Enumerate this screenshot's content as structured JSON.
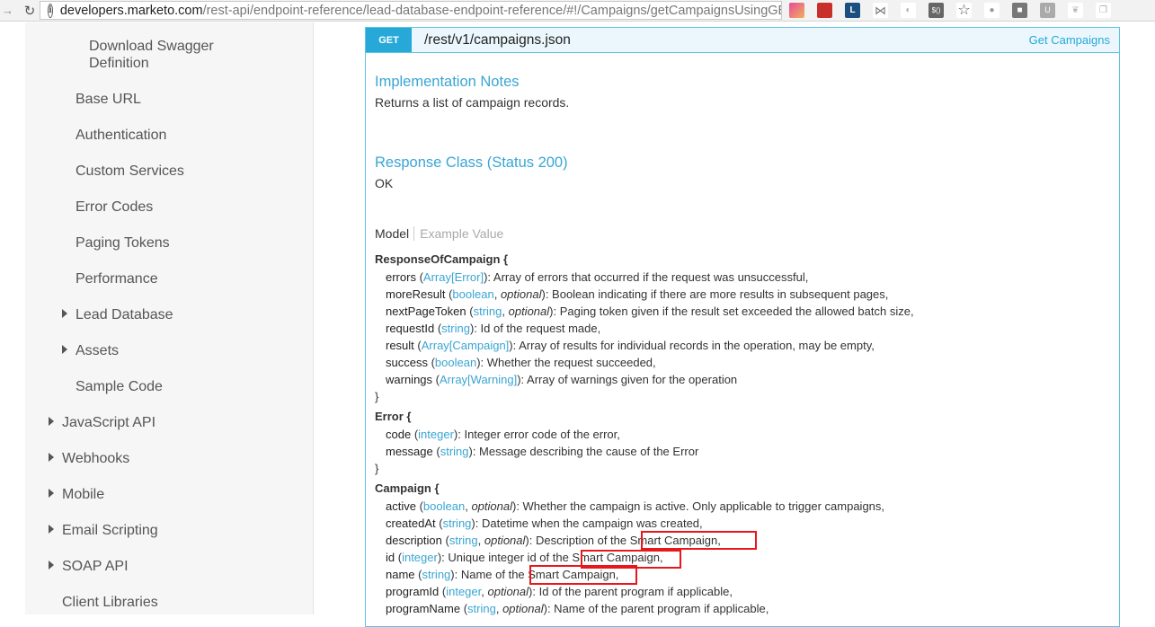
{
  "browser": {
    "url_host": "developers.marketo.com",
    "url_path": "/rest-api/endpoint-reference/lead-database-endpoint-reference/#!/Campaigns/getCampaignsUsingGE"
  },
  "sidebar": {
    "items": [
      {
        "label": "Download Swagger",
        "label2": "Definition"
      },
      {
        "label": "Base URL"
      },
      {
        "label": "Authentication"
      },
      {
        "label": "Custom Services"
      },
      {
        "label": "Error Codes"
      },
      {
        "label": "Paging Tokens"
      },
      {
        "label": "Performance"
      },
      {
        "label": "Lead Database"
      },
      {
        "label": "Assets"
      },
      {
        "label": "Sample Code"
      },
      {
        "label": "JavaScript API"
      },
      {
        "label": "Webhooks"
      },
      {
        "label": "Mobile"
      },
      {
        "label": "Email Scripting"
      },
      {
        "label": "SOAP API"
      },
      {
        "label": "Client Libraries"
      }
    ]
  },
  "operation": {
    "method": "GET",
    "path": "/rest/v1/campaigns.json",
    "summary": "Get Campaigns"
  },
  "implementation": {
    "heading": "Implementation Notes",
    "text": "Returns a list of campaign records."
  },
  "response": {
    "heading": "Response Class (Status 200)",
    "text": "OK"
  },
  "tabs": {
    "model": "Model",
    "example": "Example Value"
  },
  "model": {
    "response_of_campaign": "ResponseOfCampaign {",
    "error_head": "Error {",
    "campaign_head": "Campaign {",
    "close": "}",
    "lines": [
      {
        "prop": "errors",
        "type": "Array[Error]",
        "opt": "",
        "desc": "): Array of errors that occurred if the request was unsuccessful,"
      },
      {
        "prop": "moreResult",
        "type": "boolean",
        "opt": "optional",
        "desc": "): Boolean indicating if there are more results in subsequent pages,"
      },
      {
        "prop": "nextPageToken",
        "type": "string",
        "opt": "optional",
        "desc": "): Paging token given if the result set exceeded the allowed batch size,"
      },
      {
        "prop": "requestId",
        "type": "string",
        "opt": "",
        "desc": "): Id of the request made,"
      },
      {
        "prop": "result",
        "type": "Array[Campaign]",
        "opt": "",
        "desc": "): Array of results for individual records in the operation, may be empty,"
      },
      {
        "prop": "success",
        "type": "boolean",
        "opt": "",
        "desc": "): Whether the request succeeded,"
      },
      {
        "prop": "warnings",
        "type": "Array[Warning]",
        "opt": "",
        "desc": "): Array of warnings given for the operation"
      },
      {
        "prop": "code",
        "type": "integer",
        "opt": "",
        "desc": "): Integer error code of the error,"
      },
      {
        "prop": "message",
        "type": "string",
        "opt": "",
        "desc": "): Message describing the cause of the Error"
      },
      {
        "prop": "active",
        "type": "boolean",
        "opt": "optional",
        "desc": "): Whether the campaign is active. Only applicable to trigger campaigns,"
      },
      {
        "prop": "createdAt",
        "type": "string",
        "opt": "",
        "desc": "): Datetime when the campaign was created,"
      },
      {
        "prop": "description",
        "type": "string",
        "opt": "optional",
        "desc": "): Description of the Smart Campaign,"
      },
      {
        "prop": "id",
        "type": "integer",
        "opt": "",
        "desc": "): Unique integer id of the Smart Campaign,"
      },
      {
        "prop": "name",
        "type": "string",
        "opt": "",
        "desc": "): Name of the Smart Campaign,"
      },
      {
        "prop": "programId",
        "type": "integer",
        "opt": "optional",
        "desc": "): Id of the parent program if applicable,"
      },
      {
        "prop": "programName",
        "type": "string",
        "opt": "optional",
        "desc": "): Name of the parent program if applicable,"
      }
    ]
  },
  "colors": {
    "accent": "#26a9d8",
    "link": "#3aa5d3",
    "highlight": "#e8171b"
  }
}
